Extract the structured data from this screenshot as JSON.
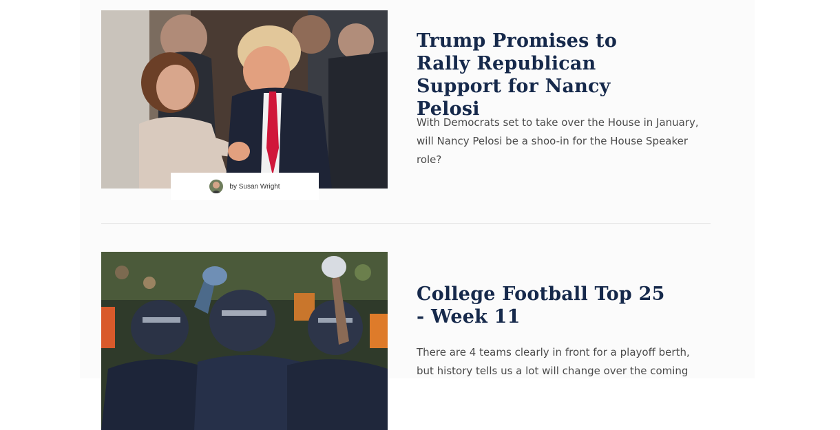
{
  "articles": [
    {
      "headline": "Trump Promises to Rally Republican Support for Nancy Pelosi",
      "excerpt": "With Democrats set to take over the House in January, will Nancy Pelosi be a shoo-in for the House Speaker role?",
      "byline": "by Susan Wright",
      "image_alt": "Nancy Pelosi shaking hands with Donald Trump"
    },
    {
      "headline": "College Football Top 25 - Week 11",
      "excerpt": "There are 4 teams clearly in front for a playoff berth, but history tells us a lot will change over the coming",
      "image_alt": "Notre Dame football players celebrating"
    }
  ],
  "colors": {
    "headline": "#16294b",
    "excerpt": "#4a4a4a",
    "divider": "#e3e3e3",
    "column_bg": "#fbfbfb"
  }
}
